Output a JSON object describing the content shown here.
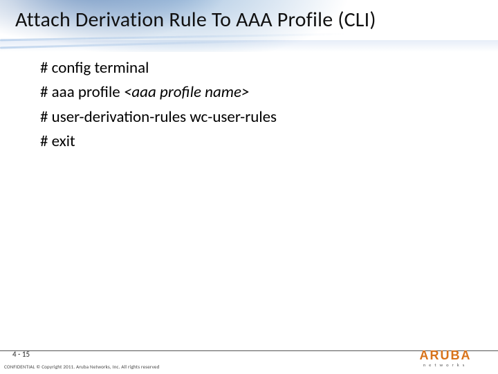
{
  "slide": {
    "title": "Attach Derivation Rule To AAA Profile (CLI)"
  },
  "cli": {
    "lines": [
      {
        "prefix": "# config terminal",
        "italic": ""
      },
      {
        "prefix": "# aaa profile ",
        "italic": "<aaa profile name>"
      },
      {
        "prefix": "# user-derivation-rules wc-user-rules",
        "italic": ""
      },
      {
        "prefix": "# exit",
        "italic": ""
      }
    ]
  },
  "footer": {
    "page": "4 - 15",
    "copyright": "CONFIDENTIAL © Copyright 2011. Aruba Networks, Inc. All rights reserved"
  },
  "logo": {
    "brand": "ARUBA",
    "sub": "networks"
  }
}
